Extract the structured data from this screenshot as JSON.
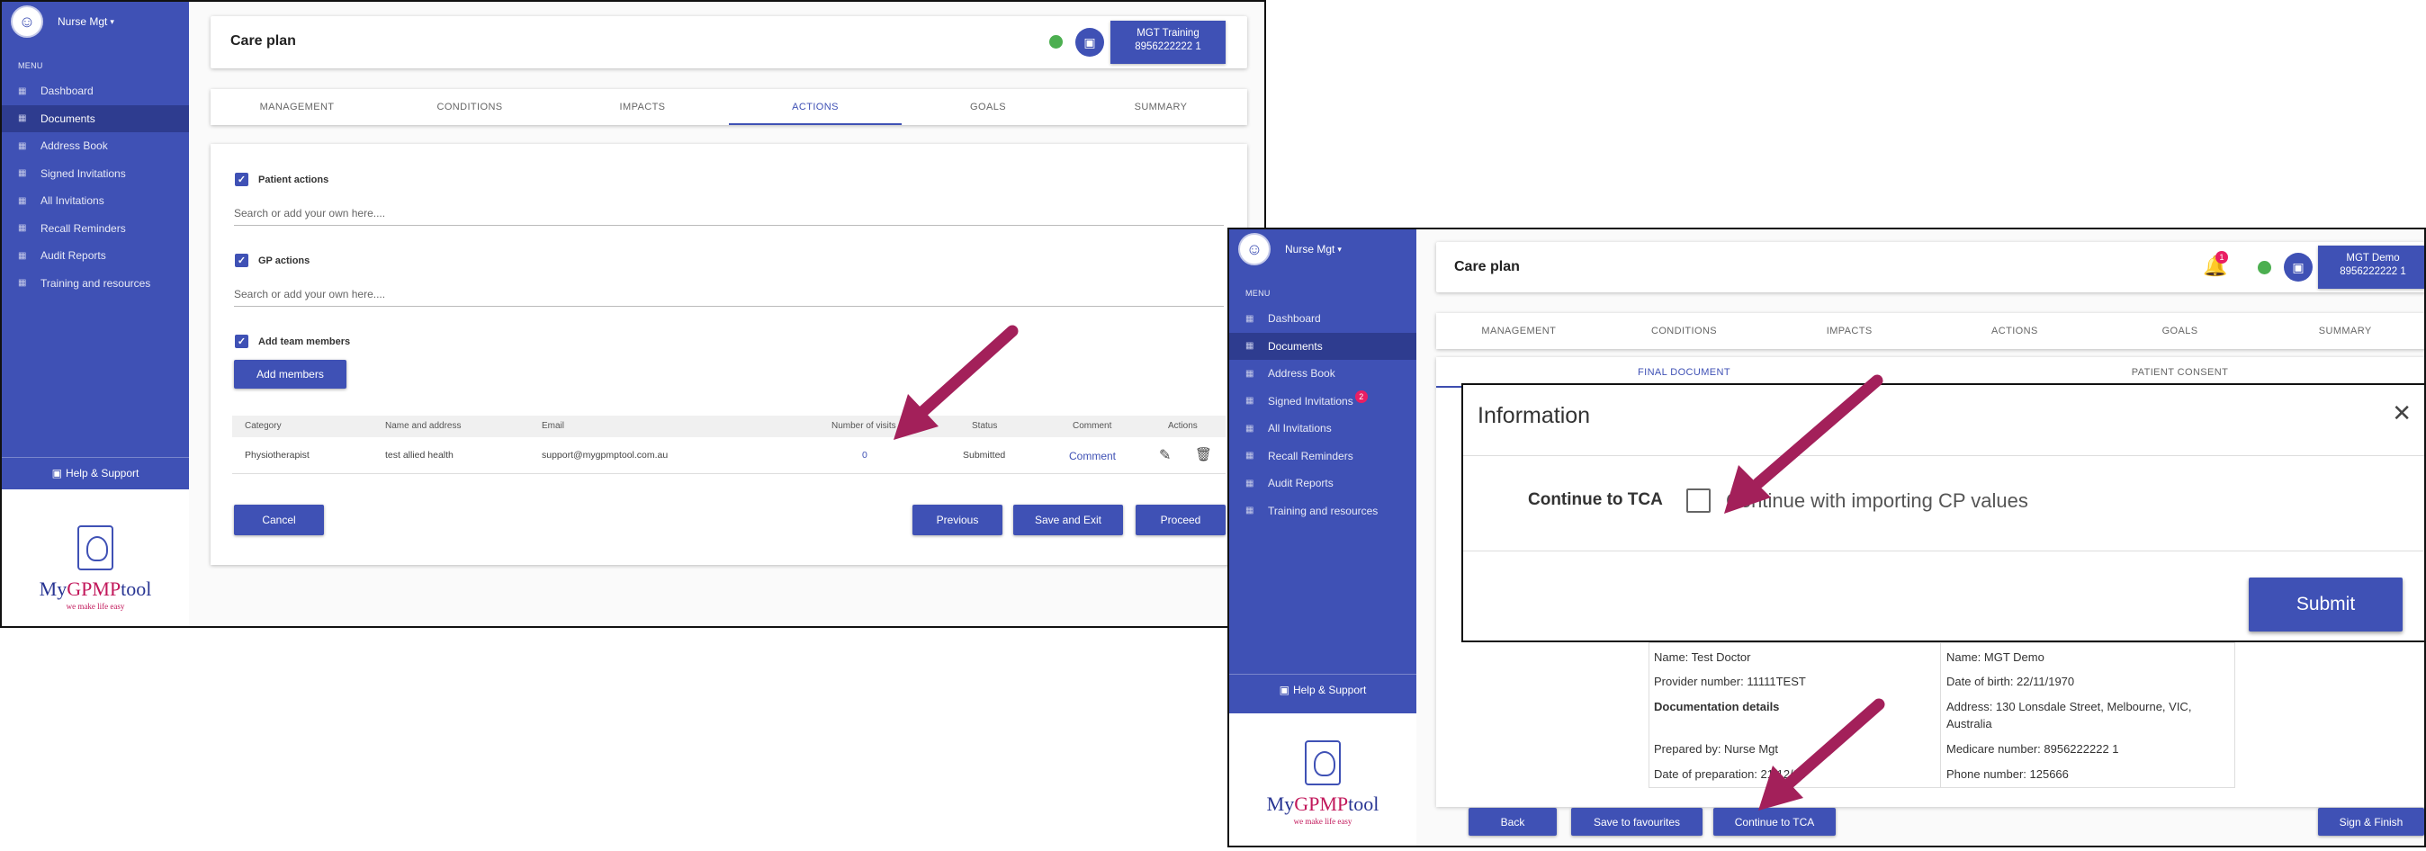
{
  "left_window": {
    "user": {
      "name": "Nurse Mgt"
    },
    "menu_label": "MENU",
    "nav": [
      "Dashboard",
      "Documents",
      "Address Book",
      "Signed Invitations",
      "All Invitations",
      "Recall Reminders",
      "Audit Reports",
      "Training and resources"
    ],
    "help": "Help & Support",
    "logo": {
      "name_a": "My",
      "name_b": "GPMP",
      "name_c": "tool",
      "tagline": "we make life easy"
    },
    "title": "Care plan",
    "patient_button": {
      "line1": "MGT Training",
      "line2": "8956222222 1"
    },
    "tabs": [
      "MANAGEMENT",
      "CONDITIONS",
      "IMPACTS",
      "ACTIONS",
      "GOALS",
      "SUMMARY"
    ],
    "active_tab": "ACTIONS",
    "sections": {
      "patient_actions": {
        "label": "Patient actions",
        "placeholder": "Search or add your own here...."
      },
      "gp_actions": {
        "label": "GP actions",
        "placeholder": "Search or add your own here...."
      },
      "team_members": {
        "label": "Add team members",
        "button": "Add members"
      }
    },
    "table": {
      "headers": [
        "Category",
        "Name and address",
        "Email",
        "Number of visits",
        "Status",
        "Comment",
        "Actions"
      ],
      "row": {
        "category": "Physiotherapist",
        "name": "test allied health",
        "email": "support@mygpmptool.com.au",
        "visits": "0",
        "status": "Submitted",
        "comment": "Comment"
      }
    },
    "buttons": {
      "cancel": "Cancel",
      "previous": "Previous",
      "save_exit": "Save and Exit",
      "proceed": "Proceed"
    }
  },
  "right_window": {
    "user": {
      "name": "Nurse Mgt"
    },
    "menu_label": "MENU",
    "nav": [
      "Dashboard",
      "Documents",
      "Address Book",
      "Signed Invitations",
      "All Invitations",
      "Recall Reminders",
      "Audit Reports",
      "Training and resources"
    ],
    "signed_badge": "2",
    "notification_badge": "1",
    "help": "Help & Support",
    "logo": {
      "name_a": "My",
      "name_b": "GPMP",
      "name_c": "tool",
      "tagline": "we make life easy"
    },
    "title": "Care plan",
    "patient_button": {
      "line1": "MGT Demo",
      "line2": "8956222222 1"
    },
    "tabs": [
      "MANAGEMENT",
      "CONDITIONS",
      "IMPACTS",
      "ACTIONS",
      "GOALS",
      "SUMMARY"
    ],
    "subtabs": [
      "FINAL DOCUMENT",
      "PATIENT CONSENT"
    ],
    "dialog": {
      "title": "Information",
      "label": "Continue to TCA",
      "option": "Continue with importing CP values",
      "submit": "Submit"
    },
    "details": {
      "left": [
        "Name: Test Doctor",
        "Provider number: 11111TEST",
        "Documentation details",
        "Prepared by: Nurse Mgt",
        "Date of preparation: 21/12/20"
      ],
      "right": [
        "Name: MGT Demo",
        "Date of birth: 22/11/1970",
        "Address: 130 Lonsdale Street, Melbourne, VIC, Australia",
        "Medicare number: 8956222222 1",
        "Phone number: 125666"
      ]
    },
    "buttons": {
      "back": "Back",
      "save_fav": "Save to favourites",
      "continue": "Continue to TCA",
      "sign": "Sign & Finish"
    }
  },
  "colors": {
    "primary": "#3f51b5",
    "arrow": "#a3205a",
    "status_green": "#4caf50",
    "badge": "#e91e63"
  }
}
